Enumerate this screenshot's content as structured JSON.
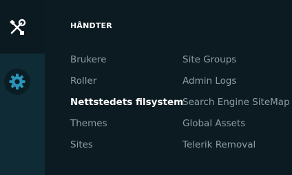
{
  "sidebar": {
    "top_icon": "tools-icon",
    "active_icon": "gear-icon"
  },
  "menu": {
    "heading": "HÅNDTER",
    "column1": [
      {
        "label": "Brukere"
      },
      {
        "label": "Roller"
      },
      {
        "label": "Nettstedets filsystem",
        "active": true
      },
      {
        "label": "Themes"
      },
      {
        "label": "Sites"
      }
    ],
    "column2": [
      {
        "label": "Site Groups"
      },
      {
        "label": "Admin Logs"
      },
      {
        "label": "Search Engine SiteMap"
      },
      {
        "label": "Global Assets"
      },
      {
        "label": "Telerik Removal"
      }
    ]
  },
  "colors": {
    "background": "#0c1b22",
    "active_rail": "#0f2b36",
    "text_muted": "#8f9da3",
    "text_active": "#ffffff",
    "icon_accent": "#2a93b8"
  }
}
